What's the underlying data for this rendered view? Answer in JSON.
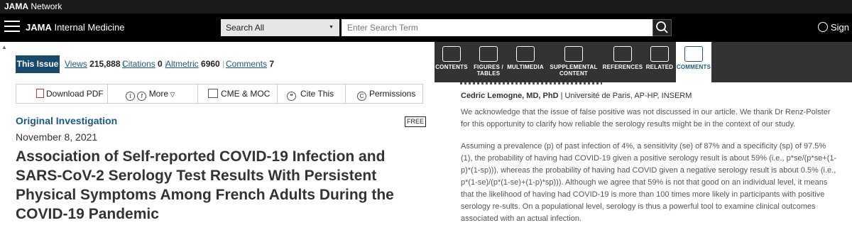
{
  "brand": {
    "bold": "JAMA",
    "rest": " Network"
  },
  "nav": {
    "journal_bold": "JAMA",
    "journal_rest": " Internal Medicine",
    "search_scope": "Search All",
    "search_placeholder": "Enter Search Term",
    "signin": "Sign In"
  },
  "tabs": {
    "this_issue": "This Issue",
    "views_label": "Views",
    "views_value": "215,888",
    "citations_label": "Citations",
    "citations_value": "0",
    "altmetric_label": "Altmetric",
    "altmetric_value": "6960",
    "comments_label": "Comments",
    "comments_value": "7"
  },
  "toolbar": {
    "download_pdf": "Download PDF",
    "more": "More",
    "cme": "CME & MOC",
    "cite": "Cite This",
    "permissions": "Permissions"
  },
  "article": {
    "type": "Original Investigation",
    "free_badge": "FREE",
    "date": "November 8, 2021",
    "title": "Association of Self-reported COVID-19 Infection and SARS-CoV-2 Serology Test Results With Persistent Physical Symptoms Among French Adults During the COVID-19 Pandemic"
  },
  "sidenav": {
    "items": [
      {
        "label1": "CONTENTS",
        "label2": ""
      },
      {
        "label1": "FIGURES /",
        "label2": "TABLES"
      },
      {
        "label1": "MULTIMEDIA",
        "label2": ""
      },
      {
        "label1": "SUPPLEMENTAL",
        "label2": "CONTENT"
      },
      {
        "label1": "REFERENCES",
        "label2": ""
      },
      {
        "label1": "RELATED",
        "label2": ""
      },
      {
        "label1": "COMMENTS",
        "label2": ""
      }
    ]
  },
  "comment": {
    "author_name": "Cedric Lemogne, MD, PhD",
    "affiliation": " | Université de Paris, AP-HP, INSERM",
    "para1": "We acknowledge that the issue of false positive was not discussed in our article. We thank Dr Renz-Polster for this opportunity to clarify how reliable the serology results might be in the context of our study.",
    "para2": "Assuming a prevalence (p) of past infection of 4%, a sensitivity (se) of 87% and a specificity (sp) of 97.5% (1), the probability of having had COVID-19 given a positive serology result is about 59% (i.e., p*se/(p*se+(1-p)*(1-sp))), whereas the probability of having had COVID given a negative serology result is about 0.5% (i.e., p*(1-se)/(p*(1-se)+(1-p)*sp))). Although we agree that 59% is not that good on an individual level, it means that the likelihood of having had COVID-19 is more than 100 times more likely in participants with positive serology re-sults. On a populational level, serology is thus a powerful tool to examine clinical outcomes associated with an actual infection."
  }
}
